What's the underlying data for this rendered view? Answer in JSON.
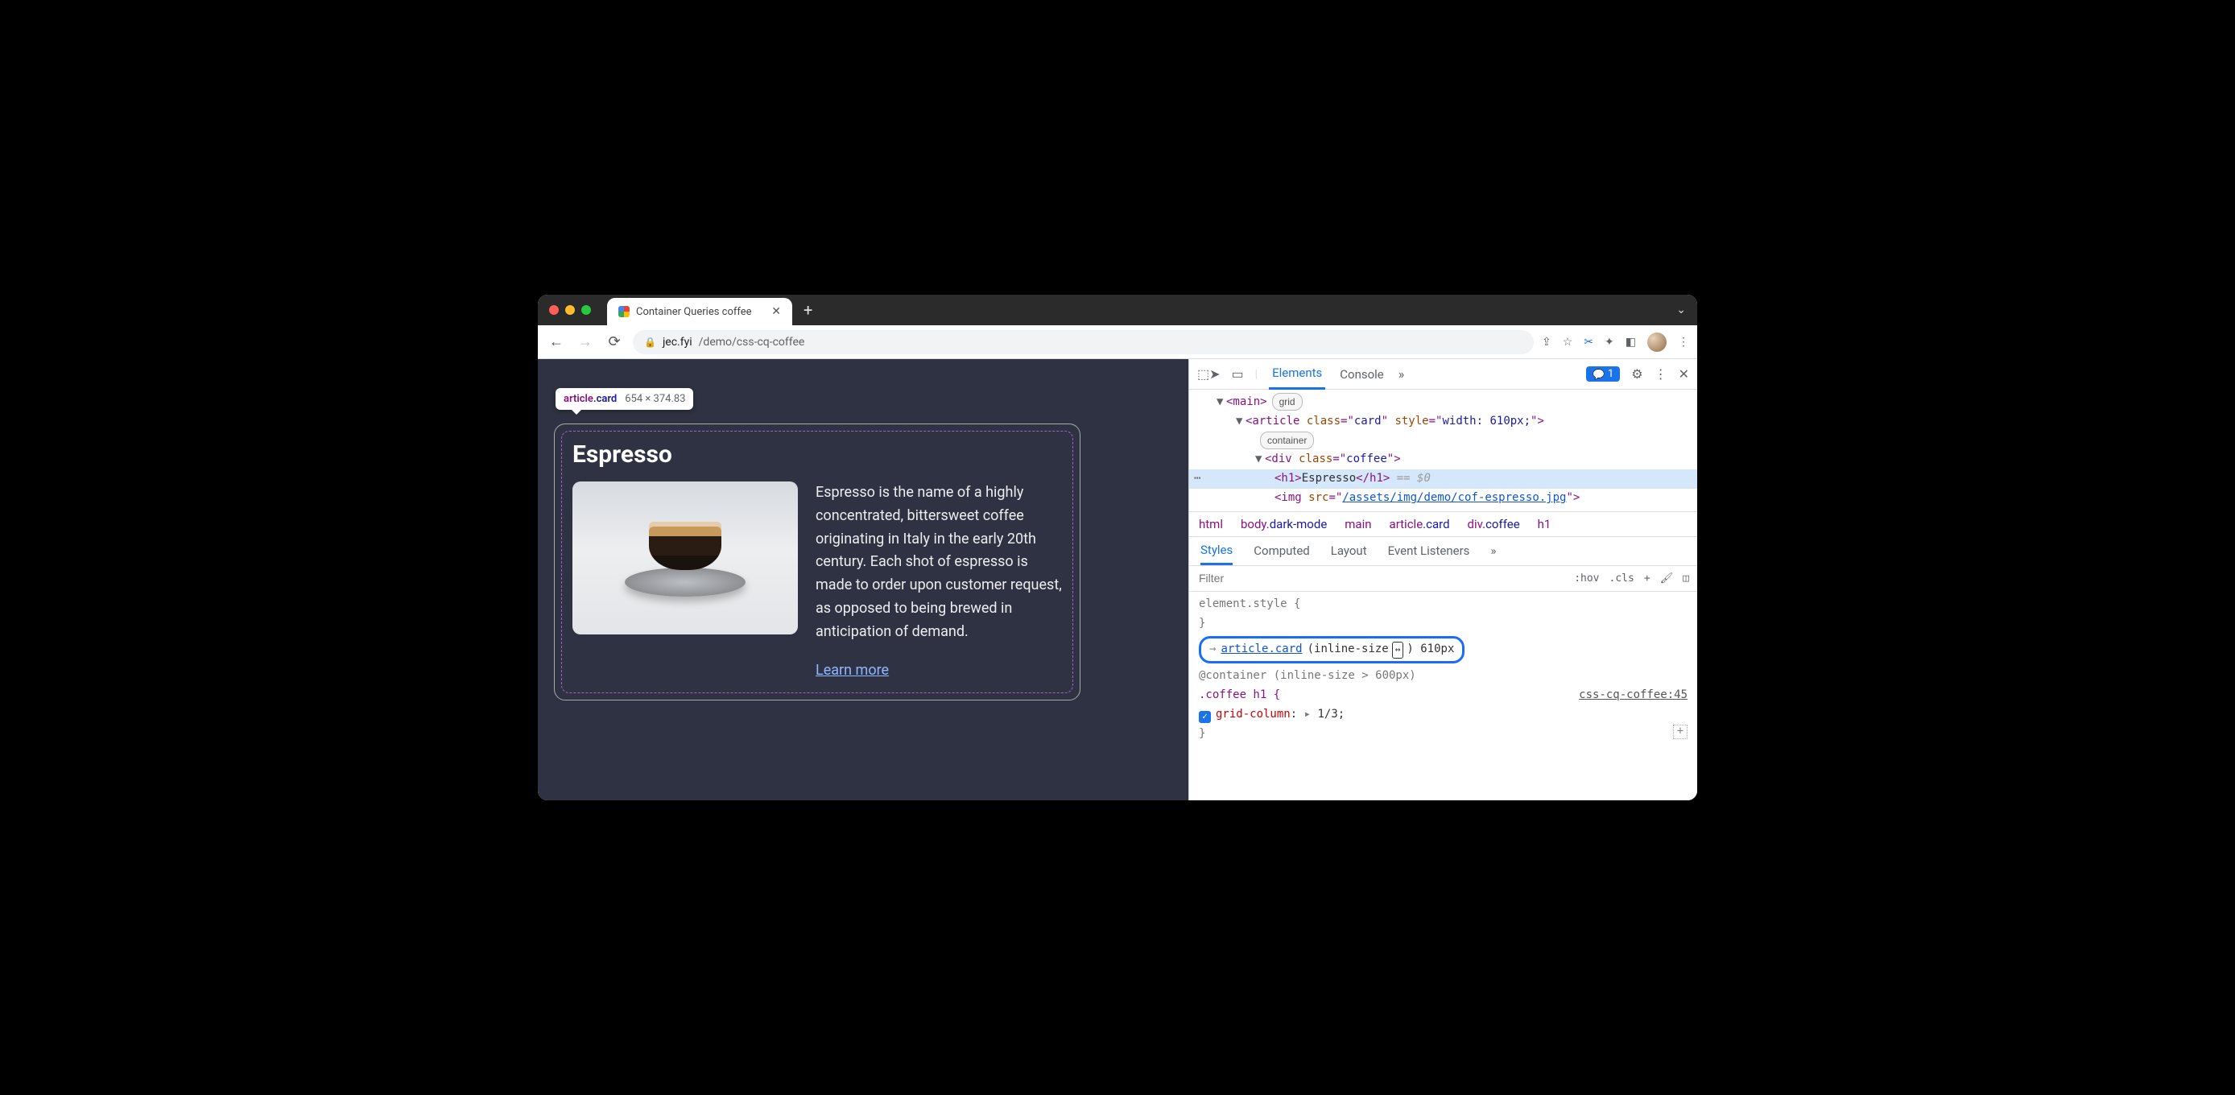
{
  "tab": {
    "title": "Container Queries coffee"
  },
  "url": {
    "host": "jec.fyi",
    "path": "/demo/css-cq-coffee"
  },
  "tooltip": {
    "tag": "article",
    "cls": ".card",
    "dims": "654 × 374.83"
  },
  "card": {
    "title": "Espresso",
    "desc": "Espresso is the name of a highly concentrated, bittersweet coffee originating in Italy in the early 20th century. Each shot of espresso is made to order upon customer request, as opposed to being brewed in anticipation of demand.",
    "link": "Learn more"
  },
  "devtools": {
    "tabs": {
      "elements": "Elements",
      "console": "Console"
    },
    "badge_count": "1",
    "dom": {
      "main_open": "<main>",
      "main_pill": "grid",
      "article_open_a": "<article ",
      "article_class_n": "class",
      "article_class_v": "card",
      "article_style_n": "style",
      "article_style_v": "width: 610px;",
      "article_close": ">",
      "article_pill": "container",
      "div_open_a": "<div ",
      "div_class_n": "class",
      "div_class_v": "coffee",
      "div_close": ">",
      "h1_open": "<h1>",
      "h1_text": "Espresso",
      "h1_close": "</h1>",
      "eq": " == $0",
      "img_open": "<img ",
      "img_src_n": "src",
      "img_src_v": "/assets/img/demo/cof-espresso.jpg",
      "img_close": "\">"
    },
    "crumbs": {
      "c1": "html",
      "c2a": "body",
      "c2b": ".dark-mode",
      "c3": "main",
      "c4a": "article",
      "c4b": ".card",
      "c5a": "div",
      "c5b": ".coffee",
      "c6": "h1"
    },
    "styles_tabs": {
      "styles": "Styles",
      "computed": "Computed",
      "layout": "Layout",
      "listeners": "Event Listeners"
    },
    "filter_placeholder": "Filter",
    "filter_actions": {
      "hov": ":hov",
      "cls": ".cls",
      "plus": "+"
    },
    "rules": {
      "elstyle": "element.style {",
      "close": "}",
      "container_sel": "article.card",
      "container_dim_label": "(inline-size",
      "container_dim_icon": "↔",
      "container_dim_val": ") 610px",
      "atcontainer": "@container (inline-size > 600px)",
      "coffee_sel": ".coffee h1 {",
      "src": "css-cq-coffee:45",
      "prop": "grid-column",
      "colon": ":",
      "tri": "▸",
      "val": "1/3",
      "semi": ";"
    }
  }
}
